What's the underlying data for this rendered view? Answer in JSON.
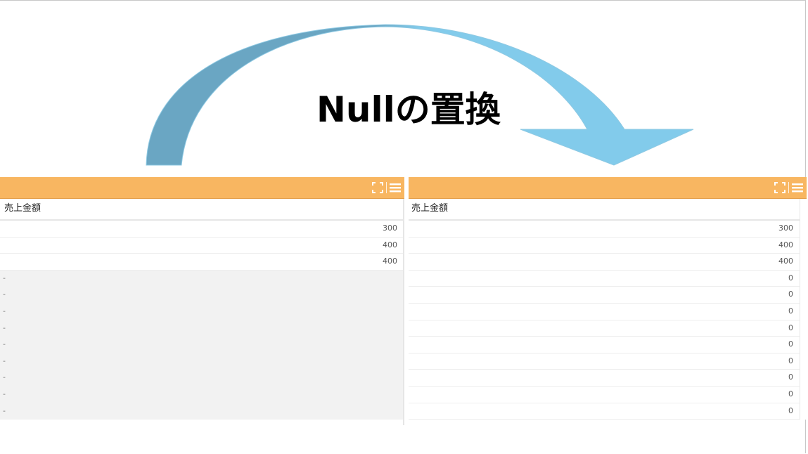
{
  "title": "Nullの置換",
  "colors": {
    "panel_header": "#f8b661",
    "arrow_dark": "#6aa6c3",
    "arrow_light": "#82cbeb",
    "null_row_bg": "#f2f2f2"
  },
  "icons": [
    "expand-icon",
    "menu-icon"
  ],
  "left_panel": {
    "column_header": "売上金額",
    "values": [
      "300",
      "400",
      "400"
    ],
    "null_values": [
      "-",
      "-",
      "-",
      "-",
      "-",
      "-",
      "-",
      "-",
      "-"
    ]
  },
  "right_panel": {
    "column_header": "売上金額",
    "values": [
      "300",
      "400",
      "400",
      "0",
      "0",
      "0",
      "0",
      "0",
      "0",
      "0",
      "0",
      "0"
    ]
  }
}
